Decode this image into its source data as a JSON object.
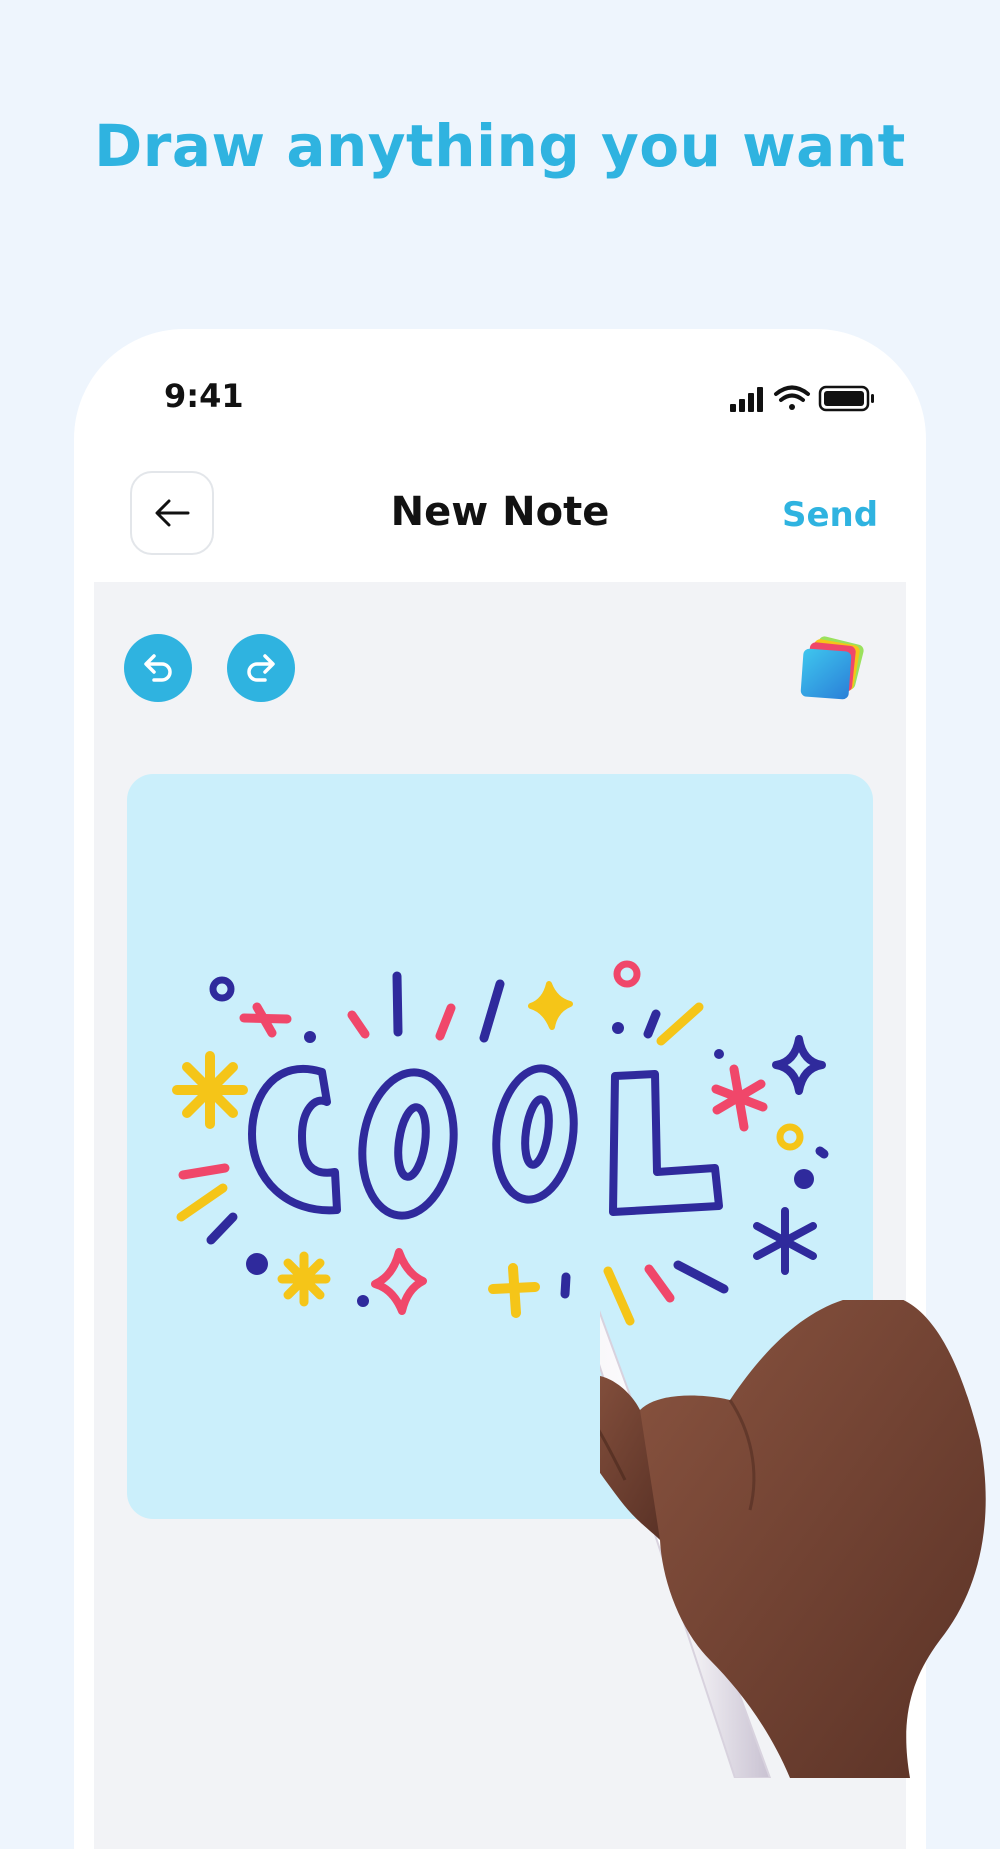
{
  "headline": "Draw anything you want",
  "status_bar": {
    "time": "9:41",
    "icons": [
      "signal-icon",
      "wifi-icon",
      "battery-icon"
    ]
  },
  "nav": {
    "back_icon": "arrow-left-icon",
    "title": "New Note",
    "send_label": "Send"
  },
  "toolbar": {
    "undo_icon": "undo-icon",
    "redo_icon": "redo-icon",
    "layers_icon": "color-layers-icon"
  },
  "canvas": {
    "drawing_word": "COOL"
  },
  "colors": {
    "accent": "#2fb3e0",
    "background": "#eef5fd",
    "canvas": "#cbeffb",
    "ink_navy": "#2f2a9c",
    "ink_red": "#f0476a",
    "ink_yellow": "#f5c518"
  }
}
